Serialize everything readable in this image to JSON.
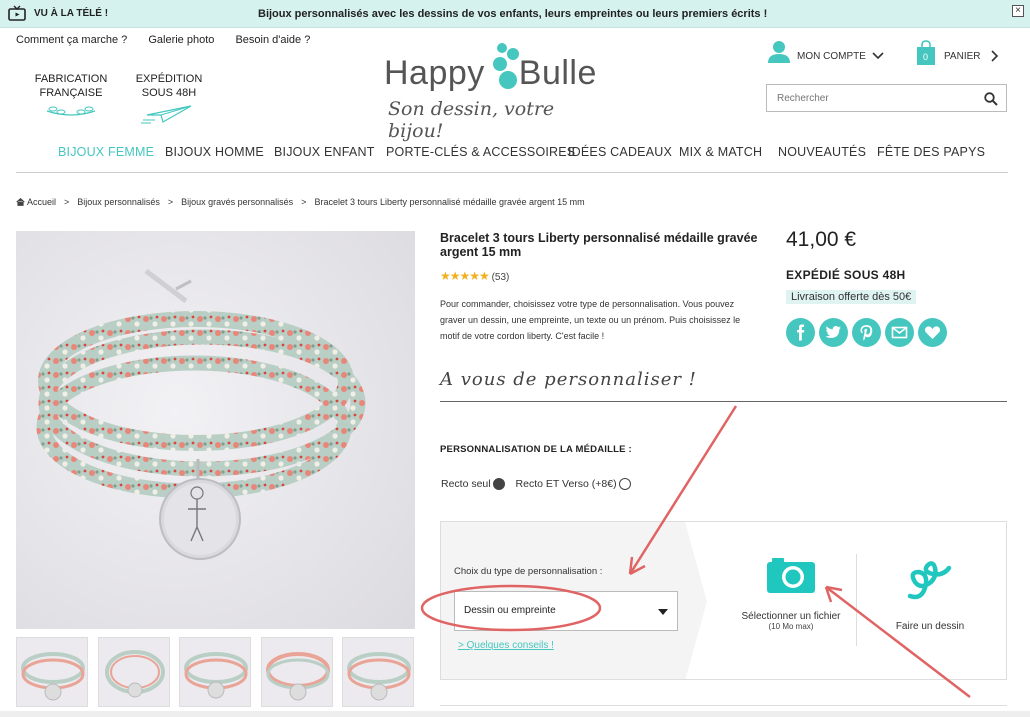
{
  "banner": {
    "tv_label": "VU À LA TÉLÉ !",
    "message": "Bijoux personnalisés avec les dessins de vos enfants, leurs empreintes ou leurs premiers écrits !",
    "close_label": "×"
  },
  "header": {
    "links": [
      "Comment ça marche ?",
      "Galerie photo",
      "Besoin d'aide ?"
    ],
    "badges": {
      "made_in_france": "FABRICATION\nFRANÇAISE",
      "shipping": "EXPÉDITION\nSOUS 48H"
    },
    "logo": {
      "brand_left": "Happy",
      "brand_right": "Bulle",
      "tagline": "Son dessin, votre bijou!"
    },
    "account_label": "MON COMPTE",
    "cart_label": "PANIER",
    "cart_count": "0",
    "search_placeholder": "Rechercher"
  },
  "nav": {
    "items": [
      "BIJOUX FEMME",
      "BIJOUX HOMME",
      "BIJOUX ENFANT",
      "PORTE-CLÉS & ACCESSOIRES",
      "IDÉES CADEAUX",
      "MIX & MATCH",
      "NOUVEAUTÉS",
      "FÊTE DES PAPYS"
    ],
    "active": "BIJOUX FEMME"
  },
  "breadcrumb": [
    "Accueil",
    "Bijoux personnalisés",
    "Bijoux gravés personnalisés",
    "Bracelet 3 tours Liberty personnalisé médaille gravée argent 15 mm"
  ],
  "product": {
    "title": "Bracelet 3 tours Liberty personnalisé médaille gravée argent 15 mm",
    "stars": "★★★★★",
    "rating_value": 5,
    "review_count": "(53)",
    "description": "Pour commander, choisissez votre type de personnalisation. Vous pouvez graver un dessin, une empreinte, un texte ou un prénom. Puis choisissez le motif de votre cordon liberty.  C'est facile !",
    "price": "41,00 €",
    "shipping": "EXPÉDIÉ SOUS 48H",
    "free_shipping": "Livraison offerte dès 50€",
    "social_icons": [
      "facebook-icon",
      "twitter-icon",
      "pinterest-icon",
      "email-icon",
      "heart-icon"
    ]
  },
  "personalise": {
    "heading": "A vous de personnaliser !",
    "medal_label": "PERSONNALISATION DE LA MÉDAILLE :",
    "options": [
      {
        "label": "Recto seul",
        "selected": true
      },
      {
        "label": "Recto ET Verso (+8€)",
        "selected": false
      }
    ],
    "type_label": "Choix du type de personnalisation :",
    "type_value": "Dessin ou empreinte",
    "tips_link": "> Quelques conseils !",
    "select_file": "Sélectionner un fichier",
    "file_limit": "(10 Mo max)",
    "draw": "Faire un dessin"
  },
  "colors": {
    "accent": "#45c7bf",
    "banner_bg": "#d6f2ef",
    "annotation": "#e06464",
    "star": "#f2b01e"
  }
}
